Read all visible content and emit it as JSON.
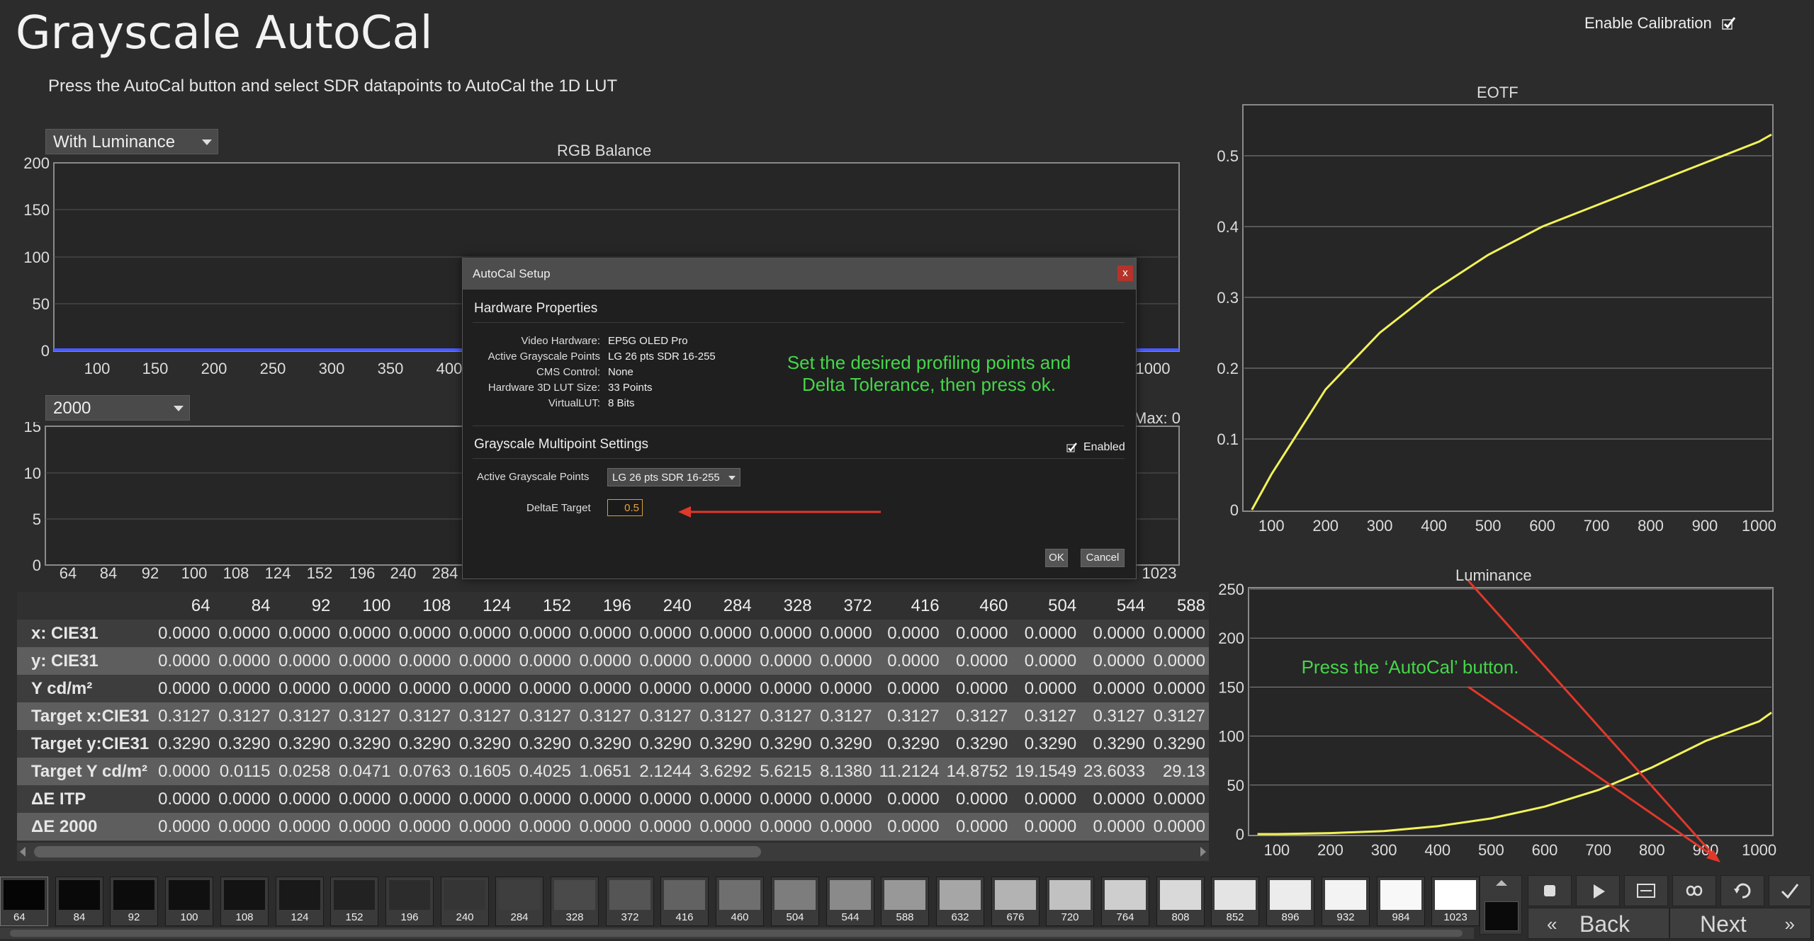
{
  "header": {
    "title": "Grayscale AutoCal",
    "subtitle": "Press the AutoCal button and select SDR datapoints to AutoCal the 1D LUT",
    "enable_calibration": "Enable Calibration"
  },
  "rgb_panel": {
    "dropdown_value": "With Luminance",
    "title": "RGB Balance",
    "y_ticks": [
      "200",
      "150",
      "100",
      "50",
      "0"
    ],
    "x_ticks": [
      "100",
      "150",
      "200",
      "250",
      "300",
      "350",
      "400",
      "1000"
    ],
    "series_color": "#4a5cff"
  },
  "de_panel": {
    "dropdown_value": "2000",
    "max_label": "Max: 0",
    "y_ticks": [
      "15",
      "10",
      "5",
      "0"
    ],
    "x_ticks": [
      "64",
      "84",
      "92",
      "100",
      "108",
      "124",
      "152",
      "196",
      "240",
      "284",
      "1023"
    ]
  },
  "eotf_chart": {
    "title": "EOTF",
    "y_ticks": [
      "0.5",
      "0.4",
      "0.3",
      "0.2",
      "0.1",
      "0"
    ],
    "x_ticks": [
      "100",
      "200",
      "300",
      "400",
      "500",
      "600",
      "700",
      "800",
      "900",
      "1000"
    ],
    "curve_color": "#f2f25a"
  },
  "luminance_chart": {
    "title": "Luminance",
    "y_ticks": [
      "250",
      "200",
      "150",
      "100",
      "50",
      "0"
    ],
    "x_ticks": [
      "100",
      "200",
      "300",
      "400",
      "500",
      "600",
      "700",
      "800",
      "900",
      "1000"
    ],
    "annotation": "Press the ‘AutoCal’ button.",
    "curve_color": "#f2f25a",
    "arrow_color": "#e0382b"
  },
  "chart_data": [
    {
      "type": "line",
      "title": "EOTF",
      "xlim": [
        50,
        1023
      ],
      "ylim": [
        0,
        0.57
      ],
      "x": [
        64,
        100,
        200,
        300,
        400,
        500,
        600,
        700,
        800,
        900,
        1000,
        1023
      ],
      "values": [
        0.0,
        0.05,
        0.17,
        0.25,
        0.31,
        0.36,
        0.4,
        0.43,
        0.46,
        0.49,
        0.52,
        0.53
      ]
    },
    {
      "type": "line",
      "title": "Luminance",
      "xlim": [
        50,
        1023
      ],
      "ylim": [
        0,
        250
      ],
      "x": [
        64,
        100,
        200,
        300,
        400,
        500,
        600,
        700,
        800,
        900,
        1000,
        1023
      ],
      "values": [
        0,
        0,
        1,
        3,
        8,
        16,
        28,
        45,
        68,
        95,
        115,
        124
      ]
    }
  ],
  "table": {
    "columns": [
      "64",
      "84",
      "92",
      "100",
      "108",
      "124",
      "152",
      "196",
      "240",
      "284",
      "328",
      "372",
      "416",
      "460",
      "504",
      "544",
      "588"
    ],
    "rows": [
      {
        "label": "x: CIE31",
        "values": [
          "0.0000",
          "0.0000",
          "0.0000",
          "0.0000",
          "0.0000",
          "0.0000",
          "0.0000",
          "0.0000",
          "0.0000",
          "0.0000",
          "0.0000",
          "0.0000",
          "0.0000",
          "0.0000",
          "0.0000",
          "0.0000",
          "0.0000"
        ]
      },
      {
        "label": "y: CIE31",
        "values": [
          "0.0000",
          "0.0000",
          "0.0000",
          "0.0000",
          "0.0000",
          "0.0000",
          "0.0000",
          "0.0000",
          "0.0000",
          "0.0000",
          "0.0000",
          "0.0000",
          "0.0000",
          "0.0000",
          "0.0000",
          "0.0000",
          "0.0000"
        ]
      },
      {
        "label": "Y cd/m²",
        "values": [
          "0.0000",
          "0.0000",
          "0.0000",
          "0.0000",
          "0.0000",
          "0.0000",
          "0.0000",
          "0.0000",
          "0.0000",
          "0.0000",
          "0.0000",
          "0.0000",
          "0.0000",
          "0.0000",
          "0.0000",
          "0.0000",
          "0.0000"
        ]
      },
      {
        "label": "Target x:CIE31",
        "values": [
          "0.3127",
          "0.3127",
          "0.3127",
          "0.3127",
          "0.3127",
          "0.3127",
          "0.3127",
          "0.3127",
          "0.3127",
          "0.3127",
          "0.3127",
          "0.3127",
          "0.3127",
          "0.3127",
          "0.3127",
          "0.3127",
          "0.3127"
        ]
      },
      {
        "label": "Target y:CIE31",
        "values": [
          "0.3290",
          "0.3290",
          "0.3290",
          "0.3290",
          "0.3290",
          "0.3290",
          "0.3290",
          "0.3290",
          "0.3290",
          "0.3290",
          "0.3290",
          "0.3290",
          "0.3290",
          "0.3290",
          "0.3290",
          "0.3290",
          "0.3290"
        ]
      },
      {
        "label": "Target Y cd/m²",
        "values": [
          "0.0000",
          "0.0115",
          "0.0258",
          "0.0471",
          "0.0763",
          "0.1605",
          "0.4025",
          "1.0651",
          "2.1244",
          "3.6292",
          "5.6215",
          "8.1380",
          "11.2124",
          "14.8752",
          "19.1549",
          "23.6033",
          "29.13"
        ]
      },
      {
        "label": "ΔE ITP",
        "values": [
          "0.0000",
          "0.0000",
          "0.0000",
          "0.0000",
          "0.0000",
          "0.0000",
          "0.0000",
          "0.0000",
          "0.0000",
          "0.0000",
          "0.0000",
          "0.0000",
          "0.0000",
          "0.0000",
          "0.0000",
          "0.0000",
          "0.0000"
        ]
      },
      {
        "label": "ΔE 2000",
        "values": [
          "0.0000",
          "0.0000",
          "0.0000",
          "0.0000",
          "0.0000",
          "0.0000",
          "0.0000",
          "0.0000",
          "0.0000",
          "0.0000",
          "0.0000",
          "0.0000",
          "0.0000",
          "0.0000",
          "0.0000",
          "0.0000",
          "0.0000"
        ]
      }
    ]
  },
  "dialog": {
    "title": "AutoCal Setup",
    "close": "x",
    "hardware_section": "Hardware Properties",
    "hardware": [
      {
        "label": "Video Hardware:",
        "value": "EP5G OLED Pro"
      },
      {
        "label": "Active Grayscale Points",
        "value": "LG 26 pts SDR 16-255"
      },
      {
        "label": "CMS Control:",
        "value": "None"
      },
      {
        "label": "Hardware 3D LUT Size:",
        "value": "33 Points"
      },
      {
        "label": "VirtualLUT:",
        "value": "8 Bits"
      }
    ],
    "multipoint_section": "Grayscale Multipoint Settings",
    "enabled_label": "Enabled",
    "active_points_label": "Active Grayscale Points",
    "active_points_value": "LG 26 pts SDR 16-255",
    "deltae_label": "DeltaE Target",
    "deltae_value": "0.5",
    "ok": "OK",
    "cancel": "Cancel",
    "annotation_line1": "Set the desired profiling points and",
    "annotation_line2": "Delta Tolerance, then press ok."
  },
  "patches": {
    "labels": [
      "64",
      "84",
      "92",
      "100",
      "108",
      "124",
      "152",
      "196",
      "240",
      "284",
      "328",
      "372",
      "416",
      "460",
      "504",
      "544",
      "588",
      "632",
      "676",
      "720",
      "764",
      "808",
      "852",
      "896",
      "932",
      "984",
      "1023"
    ],
    "colors": [
      "#050505",
      "#090909",
      "#0c0c0c",
      "#101010",
      "#131313",
      "#191919",
      "#222222",
      "#2c2c2c",
      "#353535",
      "#3e3e3e",
      "#4a4a4a",
      "#555555",
      "#626262",
      "#6f6f6f",
      "#7d7d7d",
      "#8a8a8a",
      "#989898",
      "#a6a6a6",
      "#b3b3b3",
      "#c1c1c1",
      "#cecece",
      "#d9d9d9",
      "#e4e4e4",
      "#ececec",
      "#f3f3f3",
      "#f8f8f8",
      "#ffffff"
    ]
  },
  "nav": {
    "back": "Back",
    "next": "Next"
  }
}
